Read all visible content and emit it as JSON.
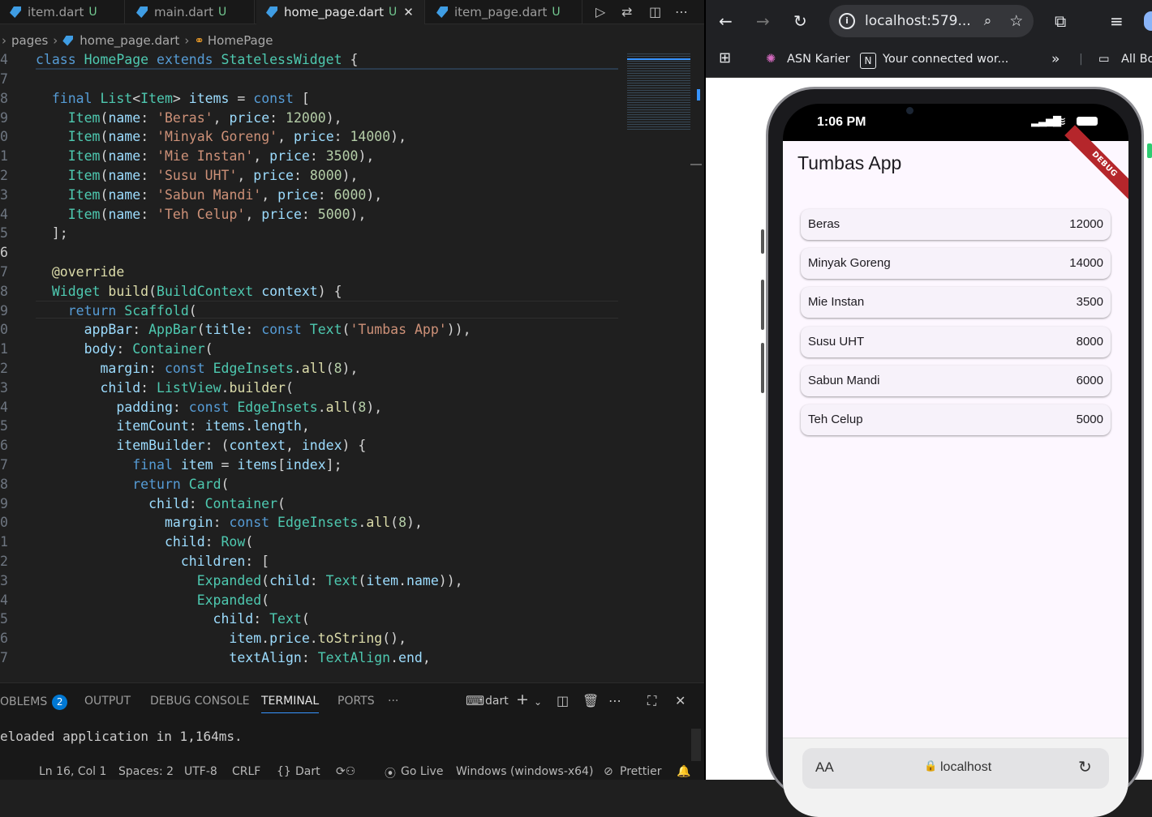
{
  "editor": {
    "tabs": [
      {
        "label": "item.dart",
        "status": "U"
      },
      {
        "label": "main.dart",
        "status": "U"
      },
      {
        "label": "home_page.dart",
        "status": "U",
        "close": "✕"
      },
      {
        "label": "item_page.dart",
        "status": "U"
      }
    ],
    "breadcrumb": [
      "pages",
      "home_page.dart",
      "HomePage"
    ],
    "sticky_line": {
      "num": "4",
      "text": "class HomePage extends StatelessWidget {"
    },
    "lines": [
      {
        "num": "7",
        "text": ""
      },
      {
        "num": "8",
        "text": "  final List<Item> items = const ["
      },
      {
        "num": "9",
        "text": "    Item(name: 'Beras', price: 12000),"
      },
      {
        "num": "0",
        "text": "    Item(name: 'Minyak Goreng', price: 14000),"
      },
      {
        "num": "1",
        "text": "    Item(name: 'Mie Instan', price: 3500),"
      },
      {
        "num": "2",
        "text": "    Item(name: 'Susu UHT', price: 8000),"
      },
      {
        "num": "3",
        "text": "    Item(name: 'Sabun Mandi', price: 6000),"
      },
      {
        "num": "4",
        "text": "    Item(name: 'Teh Celup', price: 5000),"
      },
      {
        "num": "5",
        "text": "  ];"
      },
      {
        "num": "6",
        "text": ""
      },
      {
        "num": "7",
        "text": "  @override"
      },
      {
        "num": "8",
        "text": "  Widget build(BuildContext context) {"
      },
      {
        "num": "9",
        "text": "    return Scaffold("
      },
      {
        "num": "0",
        "text": "      appBar: AppBar(title: const Text('Tumbas App')),"
      },
      {
        "num": "1",
        "text": "      body: Container("
      },
      {
        "num": "2",
        "text": "        margin: const EdgeInsets.all(8),"
      },
      {
        "num": "3",
        "text": "        child: ListView.builder("
      },
      {
        "num": "4",
        "text": "          padding: const EdgeInsets.all(8),"
      },
      {
        "num": "5",
        "text": "          itemCount: items.length,"
      },
      {
        "num": "6",
        "text": "          itemBuilder: (context, index) {"
      },
      {
        "num": "7",
        "text": "            final item = items[index];"
      },
      {
        "num": "8",
        "text": "            return Card("
      },
      {
        "num": "9",
        "text": "              child: Container("
      },
      {
        "num": "0",
        "text": "                margin: const EdgeInsets.all(8),"
      },
      {
        "num": "1",
        "text": "                child: Row("
      },
      {
        "num": "2",
        "text": "                  children: ["
      },
      {
        "num": "3",
        "text": "                    Expanded(child: Text(item.name)),"
      },
      {
        "num": "4",
        "text": "                    Expanded("
      },
      {
        "num": "5",
        "text": "                      child: Text("
      },
      {
        "num": "6",
        "text": "                        item.price.toString(),"
      },
      {
        "num": "7",
        "text": "                        textAlign: TextAlign.end,"
      }
    ],
    "panel": {
      "tabs": [
        "OBLEMS",
        "OUTPUT",
        "DEBUG CONSOLE",
        "TERMINAL",
        "PORTS",
        "···"
      ],
      "problems_count": "2",
      "shell": "dart",
      "terminal_text": "eloaded application in 1,164ms."
    },
    "statusbar": {
      "position": "Ln 16, Col 1",
      "spaces": "Spaces: 2",
      "encoding": "UTF-8",
      "eol": "CRLF",
      "language": "Dart",
      "golive": "Go Live",
      "platform": "Windows (windows-x64)",
      "prettier": "Prettier"
    }
  },
  "browser": {
    "url": "localhost:579...",
    "bookmarks": [
      "ASN Karier",
      "Your connected wor...",
      "All Bo"
    ],
    "phone": {
      "time": "1:06 PM",
      "app_title": "Tumbas App",
      "debug_banner": "DEBUG",
      "items": [
        {
          "name": "Beras",
          "price": "12000"
        },
        {
          "name": "Minyak Goreng",
          "price": "14000"
        },
        {
          "name": "Mie Instan",
          "price": "3500"
        },
        {
          "name": "Susu UHT",
          "price": "8000"
        },
        {
          "name": "Sabun Mandi",
          "price": "6000"
        },
        {
          "name": "Teh Celup",
          "price": "5000"
        }
      ],
      "safari_aa": "AA",
      "safari_host": "localhost"
    }
  }
}
